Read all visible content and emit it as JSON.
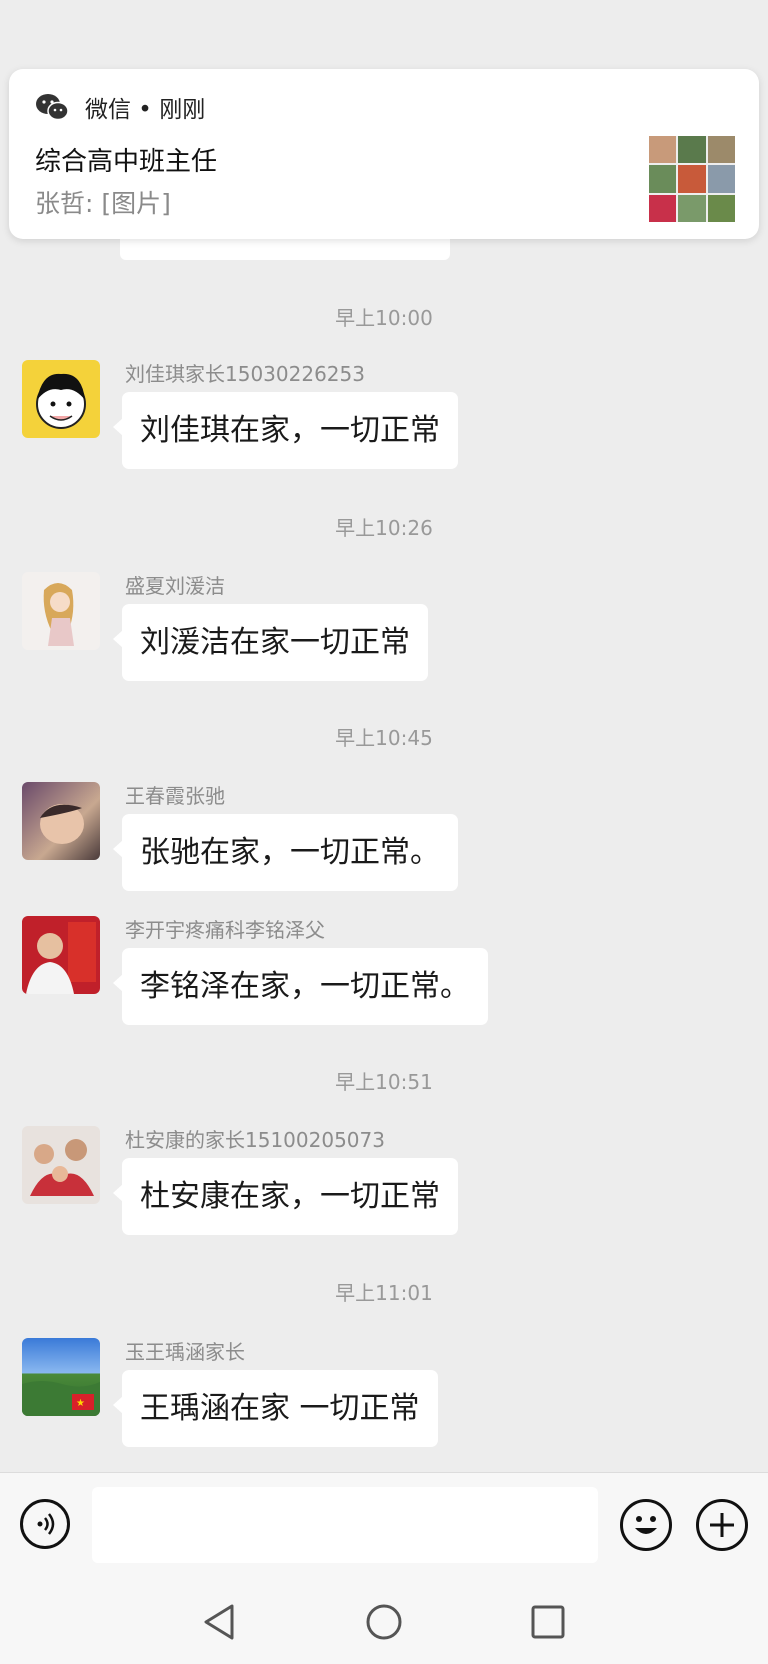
{
  "notification": {
    "app": "微信 • 刚刚",
    "title": "综合高中班主任",
    "body": "张哲: [图片]"
  },
  "messages": [
    {
      "time": "早上10:00",
      "sender": "刘佳琪家长15030226253",
      "text": "刘佳琪在家，一切正常"
    },
    {
      "time": "早上10:26",
      "sender": "盛夏刘湲洁",
      "text": "刘湲洁在家一切正常"
    },
    {
      "time": "早上10:45",
      "sender": "王春霞张驰",
      "text": "张驰在家，一切正常。"
    },
    {
      "time": "",
      "sender": "李开宇疼痛科李铭泽父",
      "text": "李铭泽在家，一切正常。"
    },
    {
      "time": "早上10:51",
      "sender": "杜安康的家长15100205073",
      "text": "杜安康在家，一切正常"
    },
    {
      "time": "早上11:01",
      "sender": "玉王瑀涵家长",
      "text": "王瑀涵在家  一切正常"
    }
  ],
  "icons": {
    "app": "wechat-icon",
    "voice": "voice-icon",
    "emoji": "emoji-icon",
    "more": "plus-icon",
    "back": "back-triangle-icon",
    "home": "home-circle-icon",
    "recents": "recents-square-icon"
  }
}
